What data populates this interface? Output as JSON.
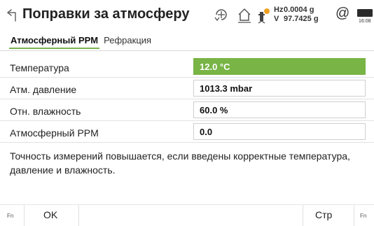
{
  "header": {
    "title": "Поправки за атмосферу",
    "hz_label": "Hz",
    "hz_value": "0.0004 g",
    "v_label": "V",
    "v_value": "97.7425 g",
    "at_symbol": "@",
    "time": "16:08",
    "icons": [
      "back-icon",
      "target-icon",
      "home-icon",
      "level-icon",
      "battery-icon"
    ]
  },
  "tabs": [
    {
      "label": "Атмосферный PPM",
      "active": true
    },
    {
      "label": "Рефракция",
      "active": false
    }
  ],
  "fields": [
    {
      "label": "Температура",
      "value": "12.0 °C",
      "active": true
    },
    {
      "label": "Атм. давление",
      "value": "1013.3 mbar",
      "active": false
    },
    {
      "label": "Отн. влажность",
      "value": "60.0 %",
      "active": false
    },
    {
      "label": "Атмосферный PPM",
      "value": "0.0",
      "active": false
    }
  ],
  "note": "Точность измерений повышается, если введены корректные температура, давление и влажность.",
  "footer": {
    "fn_left": "Fn",
    "ok_label": "OK",
    "page_label": "Стр",
    "fn_right": "Fn"
  },
  "colors": {
    "accent": "#78b446",
    "tab_underline": "#7ab34e"
  }
}
